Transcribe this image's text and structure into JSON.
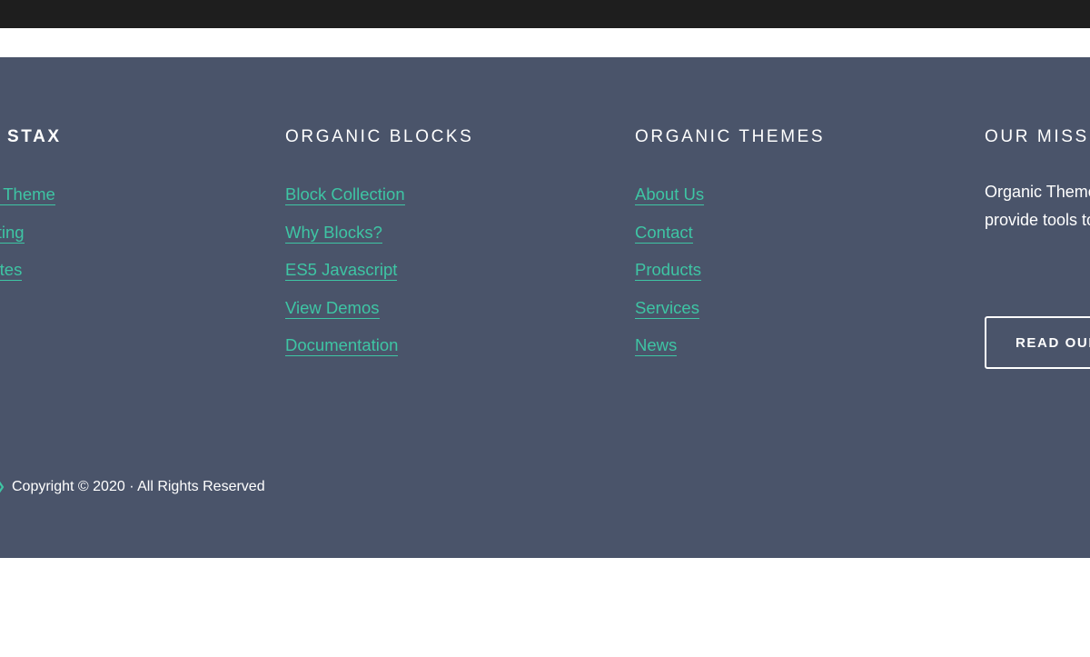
{
  "columns": [
    {
      "heading": "STAX",
      "links": [
        "Based Theme",
        "Editing",
        "Templates"
      ]
    },
    {
      "heading": "ORGANIC BLOCKS",
      "links": [
        "Block Collection",
        "Why Blocks?",
        "ES5 Javascript",
        "View Demos",
        "Documentation"
      ]
    },
    {
      "heading": "ORGANIC THEMES",
      "links": [
        "About Us",
        "Contact",
        "Products",
        "Services",
        "News"
      ]
    }
  ],
  "mission": {
    "heading": "OUR MISSION",
    "text": "Organic Themes complicated, and provide tools to themselves from",
    "button_label": "READ OUR"
  },
  "copyright": "Copyright © 2020 · All Rights Reserved",
  "colors": {
    "top_bar": "#1e1e1e",
    "footer_background": "#4a546a",
    "link": "#3ec5a4",
    "text": "#ffffff"
  },
  "icons": {
    "logo": "logo-icon"
  }
}
